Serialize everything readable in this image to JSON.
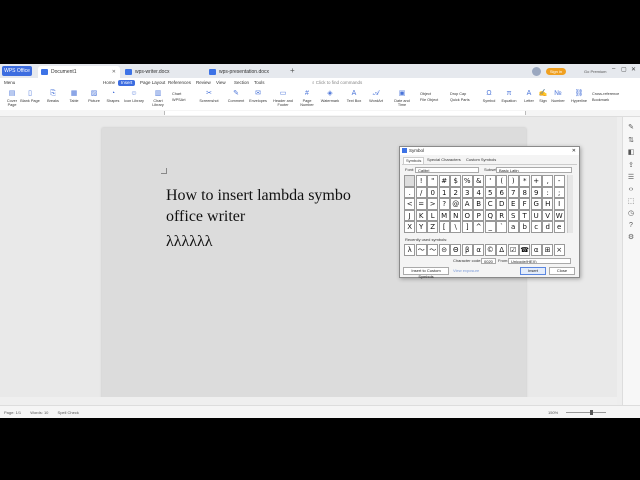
{
  "titlebar": {
    "app_button": "WPS Office",
    "tabs": [
      "Document1",
      "wps-writer.docx",
      "wps-presentation.docx"
    ],
    "signin": "Sign in",
    "premium": "Go Premium"
  },
  "menu": {
    "items": [
      "Menu",
      "Home",
      "Insert",
      "Page Layout",
      "References",
      "Review",
      "View",
      "Section",
      "Tools"
    ],
    "find": "Click to find commands"
  },
  "ribbon": {
    "buttons": [
      "Cover Page",
      "Blank Page",
      "Breaks",
      "Table",
      "Picture",
      "Shapes",
      "Icon Library",
      "Chart Library",
      "Screenshot",
      "Comment",
      "Envelopes",
      "Header and Footer",
      "Page Number",
      "Watermark",
      "Text Box",
      "WordArt",
      "Date and Time",
      "Object",
      "Quick Parts",
      "Symbol",
      "Equation",
      "Letter",
      "Sign",
      "Number",
      "Hyperline"
    ],
    "small": [
      "Chart",
      "WPSArt",
      "Drop Cap",
      "File Object",
      "Cross-reference",
      "Bookmark"
    ]
  },
  "document": {
    "line1": "How to insert lambda symbo",
    "line2": "office writer",
    "line3": "λλλλλλ"
  },
  "dialog": {
    "title": "Symbol",
    "tabs": [
      "Symbols",
      "Special Characters",
      "Custom Symbols"
    ],
    "font_label": "Font:",
    "font_value": "Calibri",
    "subset_label": "Subset:",
    "subset_value": "Basic Latin",
    "symbols": [
      " ",
      "!",
      "\"",
      "#",
      "$",
      "%",
      "&",
      "'",
      "(",
      ")",
      "*",
      "+",
      ",",
      "-",
      ".",
      "/",
      "0",
      "1",
      "2",
      "3",
      "4",
      "5",
      "6",
      "7",
      "8",
      "9",
      ":",
      ";",
      "<",
      "=",
      ">",
      "?",
      "@",
      "A",
      "B",
      "C",
      "D",
      "E",
      "F",
      "G",
      "H",
      "I",
      "J",
      "K",
      "L",
      "M",
      "N",
      "O",
      "P",
      "Q",
      "R",
      "S",
      "T",
      "U",
      "V",
      "W",
      "X",
      "Y",
      "Z",
      "[",
      "\\",
      "]",
      "^",
      "_",
      "`",
      "a",
      "b",
      "c",
      "d",
      "e"
    ],
    "recent_label": "Recently used symbols:",
    "recent": [
      "λ",
      "〜",
      "〜",
      "⊝",
      "Θ",
      "β",
      "α",
      "©",
      "Δ",
      "☑",
      "☎",
      "α",
      "⊞",
      "×"
    ],
    "charcode_label": "Character code:",
    "charcode_value": "0020",
    "from_label": "From:",
    "from_value": "Unicode(HEX)",
    "insert_custom": "Insert to Custom Symbols",
    "view_tips": "View exposure",
    "insert_btn": "Insert",
    "close_btn": "Close"
  },
  "status": {
    "page": "Page: 1/1",
    "words": "Words: 10",
    "spell": "Spell Check",
    "zoom": "150%"
  }
}
